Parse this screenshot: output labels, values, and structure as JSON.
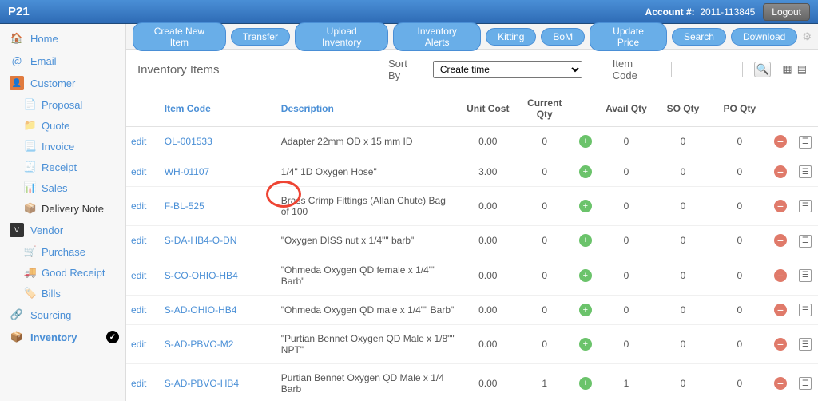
{
  "topbar": {
    "brand": "P21",
    "acct_label": "Account #:",
    "acct_num": "2011-113845",
    "logout": "Logout"
  },
  "sidebar": {
    "home": "Home",
    "email": "Email",
    "customer": "Customer",
    "proposal": "Proposal",
    "quote": "Quote",
    "invoice": "Invoice",
    "receipt": "Receipt",
    "sales": "Sales",
    "delivery": "Delivery Note",
    "vendor": "Vendor",
    "purchase": "Purchase",
    "goodreceipt": "Good Receipt",
    "bills": "Bills",
    "sourcing": "Sourcing",
    "inventory": "Inventory"
  },
  "toolbar": {
    "create": "Create New Item",
    "transfer": "Transfer",
    "upload": "Upload Inventory",
    "alerts": "Inventory Alerts",
    "kitting": "Kitting",
    "bom": "BoM",
    "update": "Update Price",
    "search": "Search",
    "download": "Download"
  },
  "subhead": {
    "title": "Inventory Items",
    "sort_label": "Sort By",
    "sort_value": "Create time",
    "code_label": "Item Code",
    "code_value": ""
  },
  "columns": {
    "edit": "",
    "code": "Item Code",
    "desc": "Description",
    "unitcost": "Unit Cost",
    "curqty": "Current Qty",
    "availqty": "Avail Qty",
    "soqty": "SO Qty",
    "poqty": "PO Qty"
  },
  "edit_label": "edit",
  "rows": [
    {
      "code": "OL-001533",
      "desc": "Adapter 22mm OD x 15 mm ID",
      "unit": "0.00",
      "cur": "0",
      "avail": "0",
      "so": "0",
      "po": "0"
    },
    {
      "code": "WH-01107",
      "desc": "1/4\" 1D Oxygen Hose\"",
      "unit": "3.00",
      "cur": "0",
      "avail": "0",
      "so": "0",
      "po": "0"
    },
    {
      "code": "F-BL-525",
      "desc": "Brass Crimp Fittings (Allan Chute) Bag of 100",
      "unit": "0.00",
      "cur": "0",
      "avail": "0",
      "so": "0",
      "po": "0"
    },
    {
      "code": "S-DA-HB4-O-DN",
      "desc": "\"Oxygen DISS nut x 1/4\"\" barb\"",
      "unit": "0.00",
      "cur": "0",
      "avail": "0",
      "so": "0",
      "po": "0"
    },
    {
      "code": "S-CO-OHIO-HB4",
      "desc": "\"Ohmeda Oxygen QD female x 1/4\"\" Barb\"",
      "unit": "0.00",
      "cur": "0",
      "avail": "0",
      "so": "0",
      "po": "0"
    },
    {
      "code": "S-AD-OHIO-HB4",
      "desc": "\"Ohmeda Oxygen QD male x 1/4\"\" Barb\"",
      "unit": "0.00",
      "cur": "0",
      "avail": "0",
      "so": "0",
      "po": "0"
    },
    {
      "code": "S-AD-PBVO-M2",
      "desc": "\"Purtian Bennet Oxygen QD Male x 1/8\"\" NPT\"",
      "unit": "0.00",
      "cur": "0",
      "avail": "0",
      "so": "0",
      "po": "0"
    },
    {
      "code": "S-AD-PBVO-HB4",
      "desc": "Purtian Bennet Oxygen QD Male x 1/4 Barb",
      "unit": "0.00",
      "cur": "1",
      "avail": "1",
      "so": "0",
      "po": "0"
    }
  ]
}
